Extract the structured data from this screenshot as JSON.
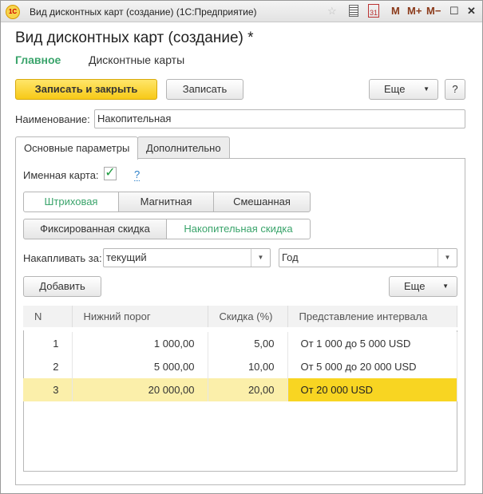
{
  "window": {
    "title": "Вид дисконтных карт (создание)  (1С:Предприятие)",
    "logo": "1C",
    "icons": [
      "star-icon",
      "calculator-icon",
      "calendar-icon"
    ],
    "m": "M",
    "mplus": "M+",
    "mminus": "M−",
    "calendar_day": "31"
  },
  "header": {
    "title": "Вид дисконтных карт (создание) *",
    "nav": [
      {
        "label": "Главное"
      },
      {
        "label": "Дисконтные карты"
      }
    ]
  },
  "toolbar": {
    "save_close": "Записать и закрыть",
    "save": "Записать",
    "more": "Еще",
    "help": "?"
  },
  "name_field": {
    "label": "Наименование:",
    "value": "Накопительная"
  },
  "tabs": [
    {
      "label": "Основные параметры"
    },
    {
      "label": "Дополнительно"
    }
  ],
  "personal": {
    "label": "Именная карта:",
    "checked": true,
    "help": "?"
  },
  "card_type": [
    "Штриховая",
    "Магнитная",
    "Смешанная"
  ],
  "discount_type": [
    "Фиксированная скидка",
    "Накопительная скидка"
  ],
  "accumulate": {
    "label": "Накапливать за:",
    "period_kind": "текущий",
    "period": "Год"
  },
  "table_toolbar": {
    "add": "Добавить",
    "more": "Еще"
  },
  "table": {
    "columns": [
      "N",
      "Нижний порог",
      "Скидка (%)",
      "Представление интервала"
    ],
    "rows": [
      [
        "1",
        "1 000,00",
        "5,00",
        "От 1 000 до 5 000 USD"
      ],
      [
        "2",
        "5 000,00",
        "10,00",
        "От 5 000 до 20 000 USD"
      ],
      [
        "3",
        "20 000,00",
        "20,00",
        "От 20 000 USD"
      ]
    ]
  },
  "colors": {
    "accent": "#3aa46b",
    "primary": "#f7c917",
    "selection": "#f8d522"
  }
}
